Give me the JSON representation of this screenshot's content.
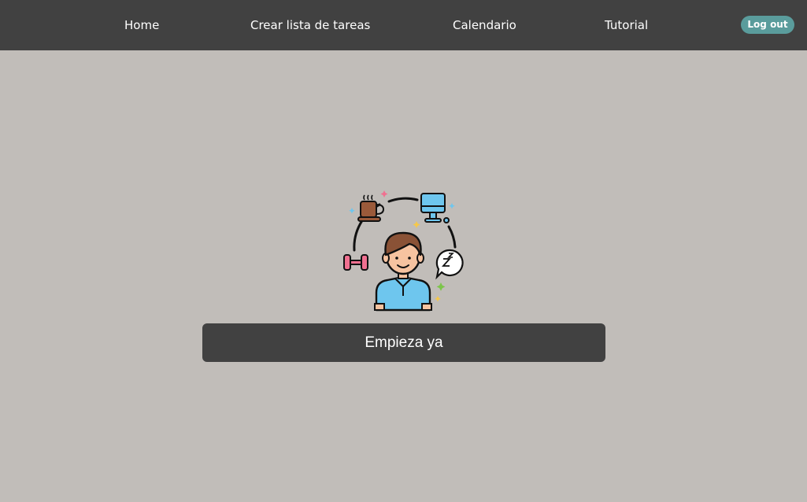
{
  "nav": {
    "items": [
      {
        "label": "Home"
      },
      {
        "label": "Crear lista de tareas"
      },
      {
        "label": "Calendario"
      },
      {
        "label": "Tutorial"
      }
    ],
    "logout_label": "Log out"
  },
  "hero": {
    "illustration_icon": "person-daily-routine-icon",
    "cta_label": "Empieza ya"
  },
  "colors": {
    "navbar": "#414141",
    "page_background": "#c1bdb9",
    "logout_button": "#5a9c9c",
    "cta_button": "#414141"
  }
}
